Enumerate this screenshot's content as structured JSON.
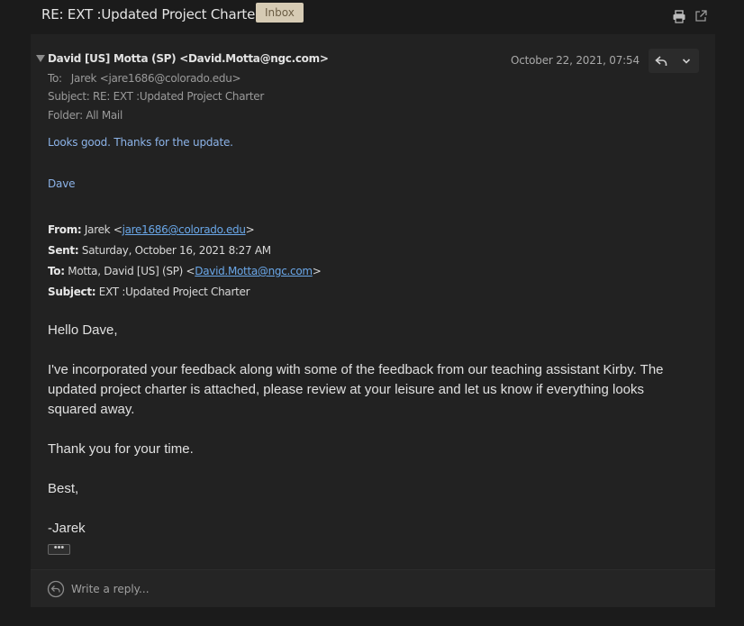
{
  "header": {
    "subject": "RE: EXT :Updated Project Charter",
    "badge": "Inbox"
  },
  "message": {
    "sender": "David [US] Motta (SP) <David.Motta@ngc.com>",
    "date": "October 22, 2021, 07:54",
    "to_label": "To:",
    "to_value": "Jarek <jare1686@colorado.edu>",
    "subject_line": "Subject: RE: EXT :Updated Project Charter",
    "folder_line": "Folder: All Mail",
    "reply_text": "Looks good.  Thanks for the update.",
    "signature": "Dave"
  },
  "quoted_header": {
    "from_label": "From:",
    "from_name": " Jarek <",
    "from_email": "jare1686@colorado.edu",
    "from_close": ">",
    "sent_label": "Sent:",
    "sent_value": " Saturday, October 16, 2021 8:27 AM",
    "to_label": "To:",
    "to_name": " Motta, David [US] (SP) <",
    "to_email": "David.Motta@ngc.com",
    "to_close": ">",
    "subject_label": "Subject:",
    "subject_value": " EXT :Updated Project Charter"
  },
  "body": {
    "greeting": "Hello Dave,",
    "paragraph": "I've incorporated your feedback along with some of the feedback from our teaching assistant Kirby. The updated project charter is attached, please review at your leisure and let us know if everything looks squared away.",
    "thanks": "Thank you for your time.",
    "closing": "Best,",
    "name": "-Jarek",
    "ellipsis": "•••"
  },
  "reply_box": {
    "placeholder": "Write a reply..."
  },
  "icons": [
    "print-icon",
    "popout-icon",
    "reply-icon",
    "chevron-down-icon",
    "collapse-triangle-icon",
    "reply-circle-icon"
  ]
}
